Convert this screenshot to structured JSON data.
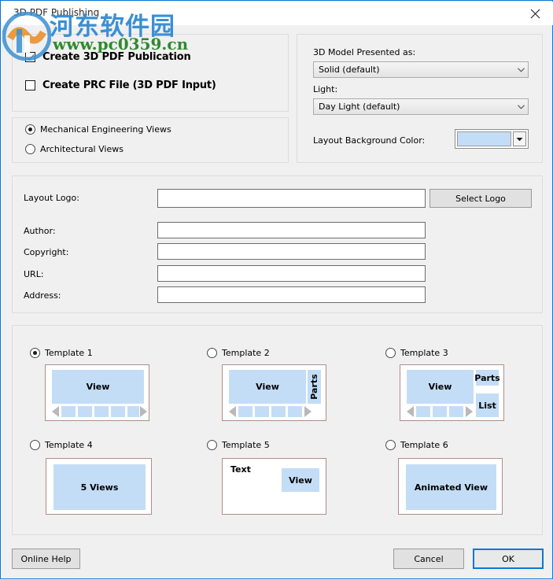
{
  "window": {
    "title": "3D PDF Publishing",
    "close_icon": "close-icon"
  },
  "watermark": {
    "brand_cn": "河东软件园",
    "url": "www.pc0359.cn"
  },
  "output_options": {
    "create_pdf": {
      "label": "Create 3D PDF Publication",
      "checked": true
    },
    "create_prc": {
      "label": "Create PRC File (3D PDF Input)",
      "checked": false
    }
  },
  "view_mode": {
    "options": [
      {
        "label": "Mechanical Engineering Views",
        "selected": true
      },
      {
        "label": "Architectural Views",
        "selected": false
      }
    ]
  },
  "model_settings": {
    "presented_as_label": "3D Model Presented as:",
    "presented_as_value": "Solid (default)",
    "light_label": "Light:",
    "light_value": "Day Light (default)",
    "background_label": "Layout Background Color:",
    "background_color": "#c3ddf7"
  },
  "metadata": {
    "fields": [
      {
        "label": "Layout Logo:",
        "value": "",
        "placeholder": ""
      },
      {
        "label": "Author:",
        "value": "",
        "placeholder": ""
      },
      {
        "label": "Copyright:",
        "value": "",
        "placeholder": ""
      },
      {
        "label": "URL:",
        "value": "",
        "placeholder": ""
      },
      {
        "label": "Address:",
        "value": "",
        "placeholder": ""
      }
    ],
    "select_logo_button": "Select Logo"
  },
  "templates": [
    {
      "label": "Template 1",
      "selected": true,
      "view_text": "View",
      "thumbs": 5
    },
    {
      "label": "Template 2",
      "selected": false,
      "view_text": "View",
      "parts_text": "Parts",
      "thumbs": 4
    },
    {
      "label": "Template 3",
      "selected": false,
      "view_text": "View",
      "parts_text": "Parts",
      "list_text": "List",
      "thumbs": 3
    },
    {
      "label": "Template 4",
      "selected": false,
      "view_text": "5 Views"
    },
    {
      "label": "Template 5",
      "selected": false,
      "text_text": "Text",
      "view_text": "View"
    },
    {
      "label": "Template 6",
      "selected": false,
      "view_text": "Animated View"
    }
  ],
  "footer": {
    "online_help": "Online Help",
    "cancel": "Cancel",
    "ok": "OK"
  },
  "colors": {
    "accent": "#0a79d6",
    "panel_bg": "#f0f0f0",
    "blue_fill": "#c3ddf7",
    "card_border": "#b08c8c"
  }
}
